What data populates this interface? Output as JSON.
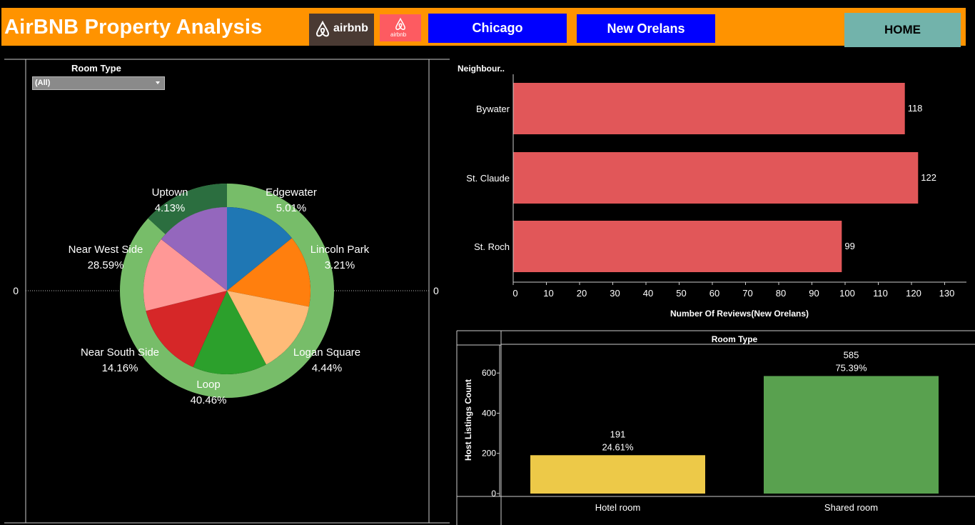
{
  "header": {
    "title": "AirBNB Property Analysis",
    "logo1_text": "airbnb",
    "logo2_text": "airbnb",
    "buttons": {
      "chicago": "Chicago",
      "new_orleans": "New Orelans",
      "home": "HOME"
    },
    "colors": {
      "header": "#FF9300",
      "nav": "#0000FF",
      "home": "#72B3AB"
    }
  },
  "filter": {
    "label": "Room Type",
    "selected": "(All)"
  },
  "pie_chart": {
    "axis_zero_left": "0",
    "axis_zero_right": "0",
    "outer_ring_color": "#77BD69",
    "chart_data": {
      "type": "pie",
      "slices": [
        {
          "name": "Edgewater",
          "pct_label": "5.01%",
          "color": "#1F77B4"
        },
        {
          "name": "Lincoln Park",
          "pct_label": "3.21%",
          "color": "#FF7F0E"
        },
        {
          "name": "Logan Square",
          "pct_label": "4.44%",
          "color": "#FFBB78"
        },
        {
          "name": "Loop",
          "pct_label": "40.46%",
          "color": "#2CA02C"
        },
        {
          "name": "Near South Side",
          "pct_label": "14.16%",
          "color": "#D62728"
        },
        {
          "name": "Near West Side",
          "pct_label": "28.59%",
          "color": "#FF9896"
        },
        {
          "name": "Uptown",
          "pct_label": "4.13%",
          "color": "#9467BD"
        }
      ],
      "outer_ring": {
        "highlight_color": "#2B6E3F"
      }
    }
  },
  "bar_chart": {
    "chart_data": {
      "type": "bar",
      "orientation": "horizontal",
      "dimension_label": "Neighbour..",
      "categories": [
        "Bywater",
        "St. Claude",
        "St. Roch"
      ],
      "values": [
        118,
        122,
        99
      ],
      "value_labels": [
        "118",
        "122",
        "99"
      ],
      "xlabel": "Number Of Reviews(New Orelans)",
      "xlim": [
        0,
        130
      ],
      "ticks": [
        "0",
        "10",
        "20",
        "30",
        "40",
        "50",
        "60",
        "70",
        "80",
        "90",
        "100",
        "110",
        "120",
        "130"
      ],
      "color": "#E15759"
    }
  },
  "column_chart": {
    "chart_data": {
      "type": "bar",
      "header": "Room Type",
      "categories": [
        "Hotel room",
        "Shared room"
      ],
      "values": [
        191,
        585
      ],
      "value_labels": [
        "191",
        "585"
      ],
      "pct_labels": [
        "24.61%",
        "75.39%"
      ],
      "ylabel": "Host Listings Count",
      "ylim": [
        0,
        660
      ],
      "ticks": [
        "0",
        "200",
        "400",
        "600"
      ],
      "colors": [
        "#EDC948",
        "#59A14F"
      ]
    }
  }
}
